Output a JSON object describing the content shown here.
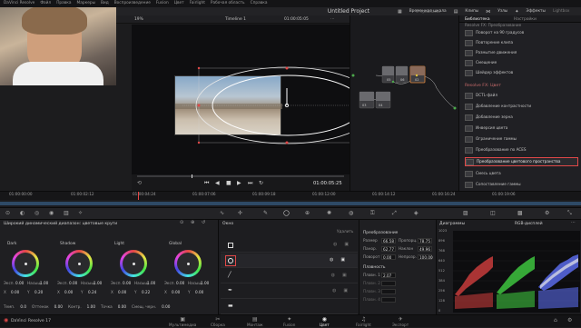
{
  "menubar": {
    "items": [
      "DaVinci Resolve",
      "Файл",
      "Правка",
      "Маркеры",
      "Вид",
      "Воспроизведение",
      "Fusion",
      "Цвет",
      "Fairlight",
      "Рабочая область",
      "Справка"
    ]
  },
  "header": {
    "project_title": "Untitled Project",
    "project_status": "С правками",
    "zoom": "19%",
    "timeline_name": "Timeline 1",
    "timecode_top": "01:00:05:05",
    "clip_label": "Клип",
    "gallery_label": "Временная шкала",
    "clips_label": "Клипы",
    "nodes_label": "Узлы",
    "effects_label": "Эффекты",
    "lightbox_label": "Lightbox"
  },
  "library": {
    "tabs": [
      "Библиотека",
      "Настройки"
    ],
    "subtitle": "Resolve FX: Преобразование",
    "items_top": [
      "Поворот на 90 градусов",
      "Повторение клипа",
      "Размытие движения",
      "Смещение",
      "Шейдер эффектов"
    ],
    "section": "Resolve FX: Цвет",
    "items_color": [
      "DCTL-файл",
      "Добавление контрастности",
      "Добавление зерна",
      "Инверсия цвета",
      "Ограничение гаммы",
      "Преобразование по ACES",
      "Преобразование цветового пространства",
      "Смесь цвета",
      "Сопоставление гаммы"
    ]
  },
  "transport": {
    "timecode": "01:00:05:25"
  },
  "ruler": {
    "ticks": [
      "01:00:00:00",
      "01:00:02:12",
      "01:00:04:24",
      "01:00:07:06",
      "01:00:09:18",
      "01:00:12:00",
      "01:00:14:12",
      "01:00:16:24",
      "01:00:19:06"
    ]
  },
  "wheels": {
    "title": "Широкий динамический диапазон: цветовые круги",
    "items": [
      {
        "name": "Dark",
        "a_label": "Эксп.",
        "a_val": "0.00",
        "b_label": "Насыщ.",
        "b_val": "1.00",
        "c_label": "X",
        "c_val": "0.00",
        "d_label": "Y",
        "d_val": "0.20"
      },
      {
        "name": "Shadow",
        "a_label": "Эксп.",
        "a_val": "0.00",
        "b_label": "Насыщ.",
        "b_val": "1.00",
        "c_label": "X",
        "c_val": "0.00",
        "d_label": "Y",
        "d_val": "0.24"
      },
      {
        "name": "Light",
        "a_label": "Эксп.",
        "a_val": "0.00",
        "b_label": "Насыщ.",
        "b_val": "1.00",
        "c_label": "X",
        "c_val": "0.00",
        "d_label": "Y",
        "d_val": "0.22"
      },
      {
        "name": "Global",
        "a_label": "Эксп.",
        "a_val": "0.00",
        "b_label": "Насыщ.",
        "b_val": "1.00",
        "c_label": "X",
        "c_val": "0.00",
        "d_label": "Y",
        "d_val": "0.00"
      }
    ],
    "footer": [
      {
        "label": "Темп.",
        "value": "0.0"
      },
      {
        "label": "Оттенок",
        "value": "0.00"
      },
      {
        "label": "Контр.",
        "value": "1.00"
      },
      {
        "label": "Точка",
        "value": "0.00"
      },
      {
        "label": "Смещ. черн.",
        "value": "0.00"
      }
    ]
  },
  "window_panel": {
    "title": "Окно",
    "delete_label": "Удалить"
  },
  "transform": {
    "title": "Преобразование",
    "rows": [
      {
        "l1": "Размер",
        "v1": "66.58",
        "l2": "Пропорц.",
        "v2": "78.75"
      },
      {
        "l1": "Панор.",
        "v1": "62.77",
        "l2": "Наклон",
        "v2": "49.96"
      },
      {
        "l1": "Поворот",
        "v1": "0.00",
        "l2": "Непрозр.",
        "v2": "100.00"
      }
    ],
    "softness_title": "Плавность",
    "softness_rows": [
      {
        "label": "Плавн. 1",
        "value": "2.07"
      },
      {
        "label": "Плавн. 2",
        "value": ""
      },
      {
        "label": "Плавн. 3",
        "value": ""
      },
      {
        "label": "Плавн. 4",
        "value": ""
      }
    ]
  },
  "scopes": {
    "title": "Диаграммы",
    "mode": "RGB-дисплей",
    "scale": [
      "1023",
      "896",
      "768",
      "640",
      "512",
      "384",
      "256",
      "128",
      "0"
    ]
  },
  "bottombar": {
    "app": "DaVinci Resolve 17",
    "pages": [
      "Мультимедиа",
      "Сборка",
      "Монтаж",
      "Fusion",
      "Цвет",
      "Fairlight",
      "Экспорт"
    ],
    "active_page": "Цвет"
  },
  "colors": {
    "accent_red": "#e04848",
    "active_page": "#e8e8e8",
    "playhead": "#e84545",
    "node_selected": "#e0863a"
  }
}
